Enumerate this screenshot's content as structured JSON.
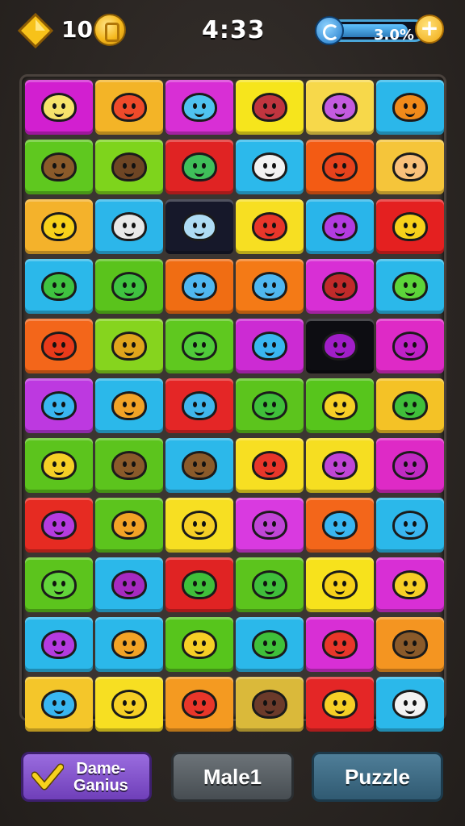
{
  "hud": {
    "coins": "10",
    "timer": "4:33",
    "energy_value": "3.0%",
    "energy_fill": 0.85,
    "plus_label": "+"
  },
  "icons": {
    "gem": "gem-icon",
    "coin": "coin-icon",
    "refresh": "refresh-icon",
    "check": "check-icon"
  },
  "board": {
    "rows": 11,
    "cols": 6,
    "tiles": [
      [
        "#d21fd0",
        "#f3b427",
        "#d82fd5",
        "#f6e51c",
        "#f7d84a",
        "#2bb7ea"
      ],
      [
        "#5fc81f",
        "#7ed41c",
        "#e02323",
        "#2cb9eb",
        "#f35b14",
        "#f5c53a"
      ],
      [
        "#f4b22b",
        "#2cb6ea",
        "#16182a",
        "#f7df22",
        "#29b5ea",
        "#e42020"
      ],
      [
        "#2bb8ea",
        "#5ac31c",
        "#f06d13",
        "#f47a16",
        "#d82fd5",
        "#2bb8ea"
      ],
      [
        "#f3661a",
        "#86d41e",
        "#5fc81f",
        "#cc2bd3",
        "#0d0d12",
        "#de2ac6"
      ],
      [
        "#bd39e0",
        "#2bb8ea",
        "#e42626",
        "#5cc41d",
        "#57c51c",
        "#f4c226"
      ],
      [
        "#5cc41d",
        "#5cc41d",
        "#2cb8ea",
        "#f7df22",
        "#f6de21",
        "#de2ac6"
      ],
      [
        "#e62b22",
        "#5cc41d",
        "#f7df22",
        "#d93ae0",
        "#f3661a",
        "#2bb8ea"
      ],
      [
        "#5cc41d",
        "#2bb8ea",
        "#e02323",
        "#5cc41d",
        "#f7e21c",
        "#d82fd5"
      ],
      [
        "#2bb8ea",
        "#2bb8ea",
        "#57c51c",
        "#2bb8ea",
        "#d82fd5",
        "#f49521"
      ],
      [
        "#f4c62a",
        "#f7df22",
        "#f49a21",
        "#dab93a",
        "#e42626",
        "#2bb8ea"
      ]
    ],
    "creatures": [
      [
        "#f6e36b",
        "#ef4a2a",
        "#4fc3f0",
        "#c0353f",
        "#c45be0",
        "#f08a1a"
      ],
      [
        "#8a5a2a",
        "#6e4524",
        "#3fbf5a",
        "#f2f2f2",
        "#e6421c",
        "#f9c07a"
      ],
      [
        "#f7d11a",
        "#e8e8e8",
        "#aedcf4",
        "#e8362a",
        "#b33be0",
        "#f7d11a"
      ],
      [
        "#3fc240",
        "#3fc240",
        "#4fb7f0",
        "#4fb7f0",
        "#c02a2a",
        "#5cd43a"
      ],
      [
        "#e83a1a",
        "#e0a41c",
        "#4fca3a",
        "#39b6f0",
        "#a11ec8",
        "#c020c8"
      ],
      [
        "#39b6f0",
        "#f2a326",
        "#3fb6ec",
        "#3fbf3a",
        "#f6cf26",
        "#3fbf3a"
      ],
      [
        "#f6cf26",
        "#8a5a2a",
        "#8a5a2a",
        "#e8362a",
        "#c045d6",
        "#c02ac2"
      ],
      [
        "#b53be0",
        "#f2a326",
        "#f6cf26",
        "#c045d6",
        "#39b6f0",
        "#39b6f0"
      ],
      [
        "#62d43a",
        "#a62ac0",
        "#3fbf3a",
        "#3fbf3a",
        "#f7d11a",
        "#f6cf26"
      ],
      [
        "#b53be0",
        "#f2a326",
        "#f6cf26",
        "#3fbf3a",
        "#e8362a",
        "#8a5a2a"
      ],
      [
        "#39b6f0",
        "#f6cf26",
        "#e8362a",
        "#6b3a2a",
        "#f6cf26",
        "#f2f2f2"
      ]
    ]
  },
  "buttons": {
    "game_label_1": "Dame-",
    "game_label_2": "Ganius",
    "match_label": "Male1",
    "puzzle_label": "Puzzle"
  }
}
